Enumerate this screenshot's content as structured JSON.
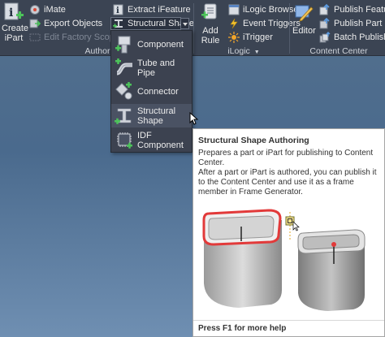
{
  "ribbon": {
    "author_panel": {
      "label": "Author",
      "create_ipart": {
        "label_line1": "Create",
        "label_line2": "iPart"
      },
      "imate": "iMate",
      "export_objects": "Export Objects",
      "edit_factory_scope": "Edit Factory Scope",
      "extract_ifeature": "Extract iFeature",
      "structural_shape": "Structural Shape",
      "add_rule": "Add Rule"
    },
    "ilogic_panel": {
      "label": "iLogic",
      "ilogic_browser": "iLogic Browser",
      "event_triggers": "Event Triggers",
      "itrigger": "iTrigger"
    },
    "content_center_panel": {
      "label": "Content Center",
      "editor": "Editor",
      "publish_feature": "Publish Feature",
      "publish_part": "Publish Part",
      "batch_publish": "Batch Publish"
    }
  },
  "dropdown": {
    "items": [
      {
        "label": "Component",
        "icon": "component-icon"
      },
      {
        "label": "Tube and Pipe",
        "icon": "tube-and-pipe-icon"
      },
      {
        "label": "Connector",
        "icon": "connector-icon"
      },
      {
        "label": "Structural Shape",
        "icon": "structural-shape-icon"
      },
      {
        "label": "IDF Component",
        "icon": "idf-component-icon"
      }
    ]
  },
  "tooltip": {
    "title": "Structural Shape Authoring",
    "description": "Prepares a part or iPart for publishing to Content Center.",
    "detail": "After a part or iPart is authored, you can publish it to the Content Center and use it as a frame member in Frame Generator.",
    "footer": "Press F1 for more help"
  },
  "colors": {
    "ribbon_bg": "#3b4453",
    "dropdown_bg": "#3c4250",
    "accent_green": "#4cc35a",
    "highlight_red": "#e23a3a"
  }
}
